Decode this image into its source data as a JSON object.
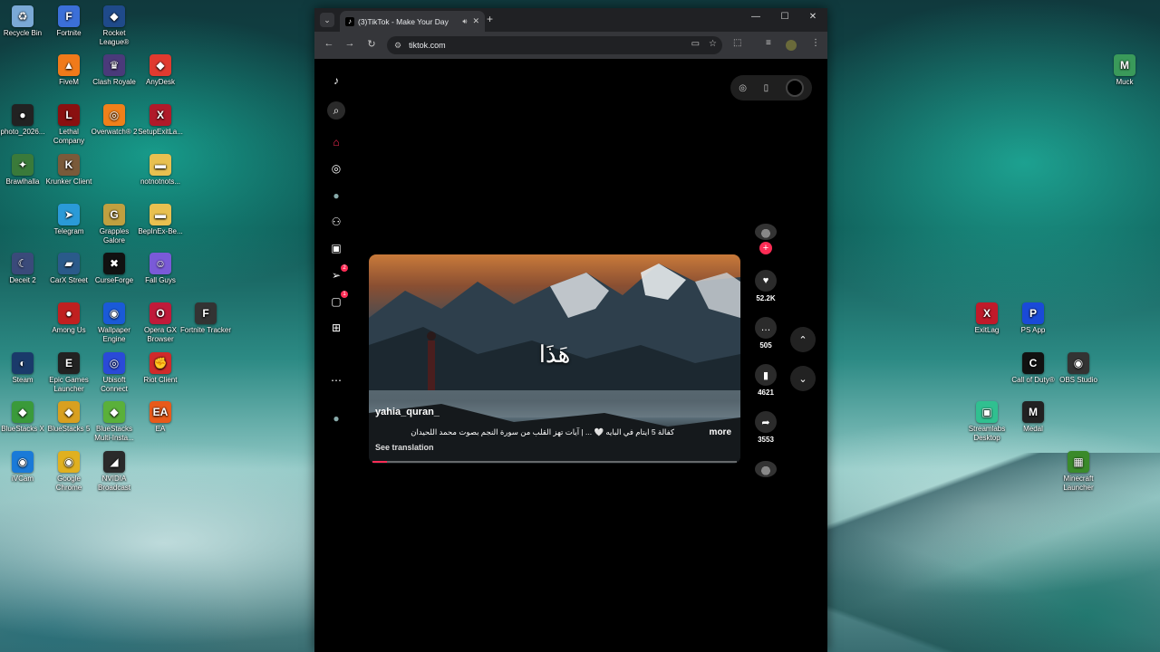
{
  "desktop": {
    "icons": [
      {
        "label": "Recycle Bin",
        "icon": "recycle-bin-icon",
        "color": "#7aa9d6",
        "glyph": "♻"
      },
      {
        "label": "Fortnite",
        "icon": "fortnite-icon",
        "color": "#3b6fd8",
        "glyph": "F"
      },
      {
        "label": "Rocket League®",
        "icon": "rocket-league-icon",
        "color": "#1f4a8a",
        "glyph": "◆"
      },
      {
        "label": "FiveM",
        "icon": "fivem-icon",
        "color": "#f07a1a",
        "glyph": "▲"
      },
      {
        "label": "Clash Royale",
        "icon": "clash-royale-icon",
        "color": "#4a3a7a",
        "glyph": "♛"
      },
      {
        "label": "AnyDesk",
        "icon": "anydesk-icon",
        "color": "#e03a2f",
        "glyph": "◆"
      },
      {
        "label": "photo_2026...",
        "icon": "photo-icon",
        "color": "#222222",
        "glyph": "●"
      },
      {
        "label": "Lethal Company",
        "icon": "lethal-company-icon",
        "color": "#8a1010",
        "glyph": "L"
      },
      {
        "label": "Overwatch® 2",
        "icon": "overwatch-icon",
        "color": "#f0801a",
        "glyph": "◎"
      },
      {
        "label": "SetupExitLa...",
        "icon": "exitlag-setup-icon",
        "color": "#b01a2a",
        "glyph": "X"
      },
      {
        "label": "Brawlhalla",
        "icon": "brawlhalla-icon",
        "color": "#3a7a3a",
        "glyph": "✦"
      },
      {
        "label": "Krunker Client",
        "icon": "krunker-icon",
        "color": "#7a5a3a",
        "glyph": "K"
      },
      {
        "label": "notnotnots...",
        "icon": "folder-icon",
        "color": "#e8c050",
        "glyph": "▬"
      },
      {
        "label": "Telegram",
        "icon": "telegram-icon",
        "color": "#2a9ad8",
        "glyph": "➤"
      },
      {
        "label": "Grapples Galore",
        "icon": "grapples-galore-icon",
        "color": "#c0a040",
        "glyph": "G"
      },
      {
        "label": "BepInEx-Be...",
        "icon": "folder-icon",
        "color": "#e8c050",
        "glyph": "▬"
      },
      {
        "label": "Deceit 2",
        "icon": "deceit-icon",
        "color": "#3a4a7a",
        "glyph": "☾"
      },
      {
        "label": "CarX Street",
        "icon": "carx-street-icon",
        "color": "#2a5a8a",
        "glyph": "▰"
      },
      {
        "label": "CurseForge",
        "icon": "curseforge-icon",
        "color": "#111111",
        "glyph": "✖"
      },
      {
        "label": "Fall Guys",
        "icon": "fall-guys-icon",
        "color": "#7a5ad8",
        "glyph": "☺"
      },
      {
        "label": "Among Us",
        "icon": "among-us-icon",
        "color": "#c02020",
        "glyph": "●"
      },
      {
        "label": "Wallpaper Engine",
        "icon": "wallpaper-engine-icon",
        "color": "#1a5ad8",
        "glyph": "◉"
      },
      {
        "label": "Opera GX Browser",
        "icon": "opera-gx-icon",
        "color": "#c01a3a",
        "glyph": "O"
      },
      {
        "label": "Fortnite Tracker",
        "icon": "fortnite-tracker-icon",
        "color": "#333333",
        "glyph": "F"
      },
      {
        "label": "Steam",
        "icon": "steam-icon",
        "color": "#1a3a6a",
        "glyph": "◐"
      },
      {
        "label": "Epic Games Launcher",
        "icon": "epic-games-icon",
        "color": "#222222",
        "glyph": "E"
      },
      {
        "label": "Ubisoft Connect",
        "icon": "ubisoft-icon",
        "color": "#2a4ad8",
        "glyph": "◎"
      },
      {
        "label": "Riot Client",
        "icon": "riot-client-icon",
        "color": "#d02a2a",
        "glyph": "✊"
      },
      {
        "label": "BlueStacks X",
        "icon": "bluestacks-x-icon",
        "color": "#3a9a3a",
        "glyph": "◆"
      },
      {
        "label": "BlueStacks 5",
        "icon": "bluestacks-5-icon",
        "color": "#d8a020",
        "glyph": "◆"
      },
      {
        "label": "BlueStacks Multi-Insta...",
        "icon": "bluestacks-multi-icon",
        "color": "#5ab03a",
        "glyph": "◆"
      },
      {
        "label": "EA",
        "icon": "ea-icon",
        "color": "#e85a1a",
        "glyph": "EA"
      },
      {
        "label": "iVCam",
        "icon": "ivcam-icon",
        "color": "#1a7ad8",
        "glyph": "◉"
      },
      {
        "label": "Google Chrome",
        "icon": "chrome-icon",
        "color": "#e0b020",
        "glyph": "◉"
      },
      {
        "label": "NVIDIA Broadcast",
        "icon": "nvidia-broadcast-icon",
        "color": "#2a2a2a",
        "glyph": "◢"
      },
      {
        "label": "Muck",
        "icon": "muck-icon",
        "color": "#3a9a5a",
        "glyph": "M"
      },
      {
        "label": "ExitLag",
        "icon": "exitlag-icon",
        "color": "#c01a2a",
        "glyph": "X"
      },
      {
        "label": "PS App",
        "icon": "ps-app-icon",
        "color": "#1a4ad8",
        "glyph": "P"
      },
      {
        "label": "Call of Duty®",
        "icon": "call-of-duty-icon",
        "color": "#111111",
        "glyph": "C"
      },
      {
        "label": "OBS Studio",
        "icon": "obs-studio-icon",
        "color": "#333333",
        "glyph": "◉"
      },
      {
        "label": "Streamlabs Desktop",
        "icon": "streamlabs-icon",
        "color": "#30c090",
        "glyph": "▣"
      },
      {
        "label": "Medal",
        "icon": "medal-icon",
        "color": "#222222",
        "glyph": "M"
      },
      {
        "label": "Minecraft Launcher",
        "icon": "minecraft-launcher-icon",
        "color": "#3a8a2a",
        "glyph": "▦"
      }
    ]
  },
  "browser": {
    "tab_title": "(3)TikTok - Make Your Day",
    "tab_favicon": "tiktok-favicon",
    "url": "tiktok.com",
    "new_tab": "+",
    "window_controls": {
      "minimize": "—",
      "maximize": "☐",
      "close": "✕"
    },
    "nav": {
      "back": "←",
      "forward": "→",
      "reload": "↻"
    }
  },
  "tiktok": {
    "sidebar": [
      {
        "name": "tiktok-logo-icon",
        "glyph": "♪",
        "badge": ""
      },
      {
        "name": "search-icon",
        "glyph": "⌕",
        "badge": ""
      },
      {
        "name": "home-icon",
        "glyph": "⌂",
        "badge": ""
      },
      {
        "name": "explore-icon",
        "glyph": "◎",
        "badge": ""
      },
      {
        "name": "following-avatar-icon",
        "glyph": "●",
        "badge": ""
      },
      {
        "name": "friends-icon",
        "glyph": "⚇",
        "badge": ""
      },
      {
        "name": "live-icon",
        "glyph": "▣",
        "badge": ""
      },
      {
        "name": "messages-icon",
        "glyph": "➢",
        "badge": "2"
      },
      {
        "name": "inbox-icon",
        "glyph": "▢",
        "badge": "1"
      },
      {
        "name": "upload-icon",
        "glyph": "⊞",
        "badge": ""
      },
      {
        "name": "more-icon",
        "glyph": "⋯",
        "badge": ""
      },
      {
        "name": "profile-avatar-icon",
        "glyph": "●",
        "badge": ""
      }
    ],
    "video": {
      "overlay_text": "هَذَا",
      "author": "yahia_quran_",
      "description": "كفالة 5 ايتام في البايه 🤍 ... | آيات تهز القلب من سورة النجم بصوت محمد اللحيدان",
      "more_label": "more",
      "see_translation": "See translation",
      "progress": 0.04
    },
    "actions": {
      "likes": "52.2K",
      "comments": "505",
      "saves": "4621",
      "shares": "3553"
    },
    "accent": "#fe2c55"
  }
}
